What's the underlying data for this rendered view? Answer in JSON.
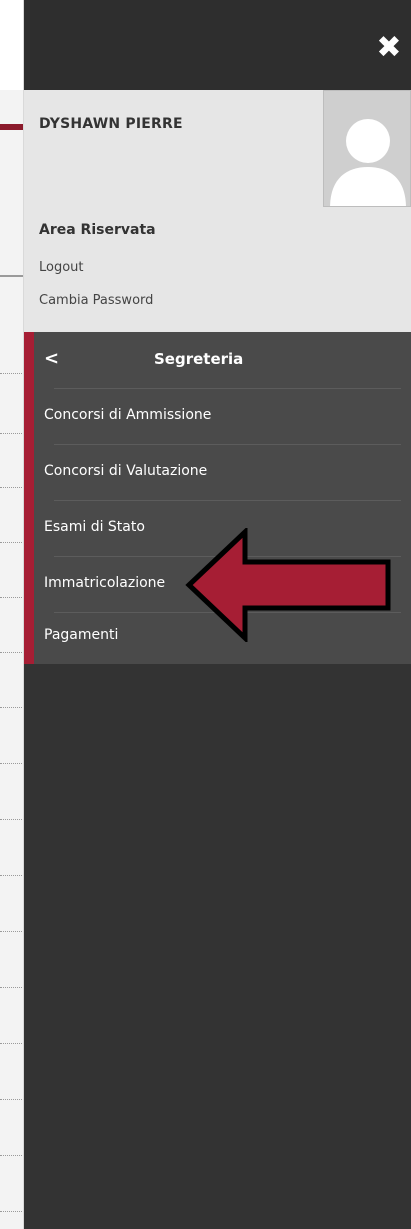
{
  "user": {
    "name": "DYSHAWN PIERRE",
    "area_title": "Area Riservata",
    "links": [
      "Logout",
      "Cambia Password"
    ]
  },
  "menu": {
    "title": "Segreteria",
    "items": [
      {
        "label": "Concorsi di Ammissione"
      },
      {
        "label": "Concorsi di Valutazione"
      },
      {
        "label": "Esami di Stato"
      },
      {
        "label": "Immatricolazione"
      },
      {
        "label": "Pagamenti"
      }
    ]
  },
  "icons": {
    "close": "close-icon",
    "back": "chevron-left-icon",
    "avatar": "user-avatar-icon",
    "annotation": "left-arrow-annotation"
  },
  "colors": {
    "accent": "#a61e34",
    "panel": "#333333",
    "menu_bg": "#4a4a4a",
    "user_bg": "#e6e6e6",
    "arrow": "#a61e34"
  }
}
